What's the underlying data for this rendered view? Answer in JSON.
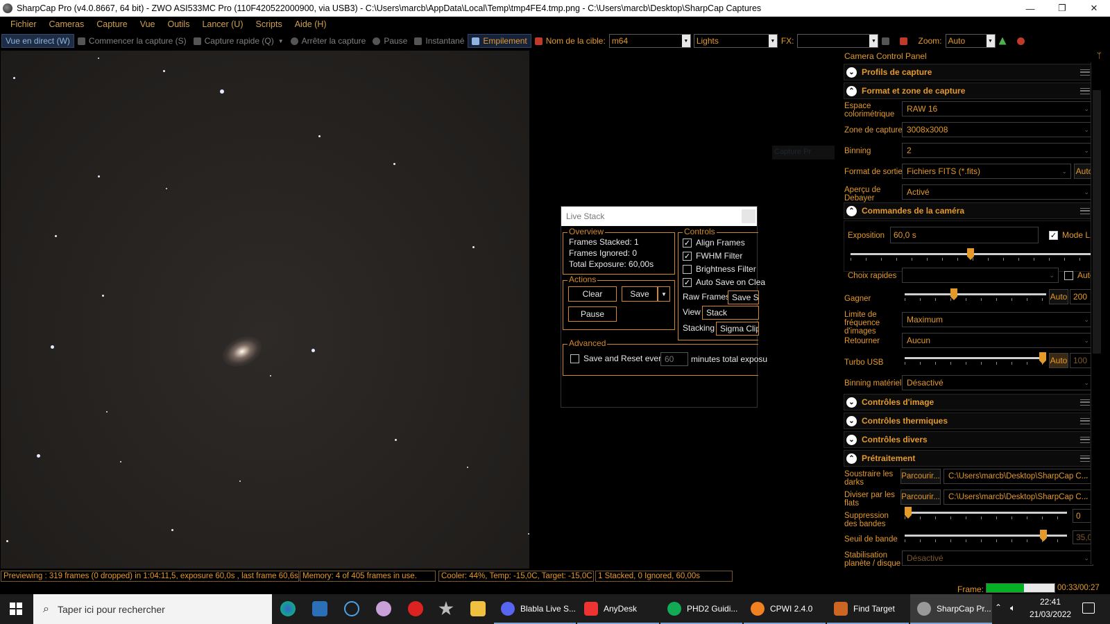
{
  "window": {
    "title": "SharpCap Pro (v4.0.8667, 64 bit) - ZWO ASI533MC Pro (110F420522000900, via USB3) - C:\\Users\\marcb\\AppData\\Local\\Temp\\tmp4FE4.tmp.png - C:\\Users\\marcb\\Desktop\\SharpCap Captures",
    "minimize": "—",
    "maximize": "❐",
    "close": "✕"
  },
  "menu": [
    "Fichier",
    "Cameras",
    "Capture",
    "Vue",
    "Outils",
    "Lancer (U)",
    "Scripts",
    "Aide (H)"
  ],
  "toolbar": {
    "live_view": "Vue en direct (W)",
    "start_capture": "Commencer la capture (S)",
    "quick_capture": "Capture rapide (Q)",
    "stop_capture": "Arrêter la capture",
    "pause": "Pause",
    "snapshot": "Instantané",
    "stacking": "Empilement",
    "target_label": "Nom de la cible:",
    "target_value": "m64",
    "frame_type": "Lights",
    "fx_label": "FX:",
    "fx_value": "",
    "zoom_label": "Zoom:",
    "zoom_value": "Auto"
  },
  "ghost_text": "Capture Pr",
  "live_stack": {
    "title": "Live Stack",
    "overview": {
      "label": "Overview",
      "frames_stacked": "Frames Stacked:  1",
      "frames_ignored": "Frames Ignored:  0",
      "total_exposure": "Total Exposure:    60,00s"
    },
    "actions": {
      "label": "Actions",
      "clear": "Clear",
      "save": "Save",
      "pause": "Pause"
    },
    "controls": {
      "label": "Controls",
      "align_frames": "Align Frames",
      "fwhm_filter": "FWHM Filter",
      "brightness_filter": "Brightness Filter",
      "auto_save": "Auto Save on Clea",
      "raw_frames_label": "Raw Frames",
      "raw_frames_value": "Save St",
      "view_label": "View",
      "view_value": "Stack",
      "stacking_label": "Stacking",
      "stacking_value": "Sigma Clipp"
    },
    "advanced": {
      "label": "Advanced",
      "save_reset": "Save and Reset every",
      "minutes_value": "60",
      "minutes_suffix": "minutes total exposu"
    }
  },
  "panel": {
    "title": "Camera Control Panel",
    "sections": {
      "capture_profiles": "Profils de capture",
      "format_area": "Format et zone de capture",
      "camera_controls": "Commandes de la caméra",
      "image_controls": "Contrôles d'image",
      "thermal_controls": "Contrôles thermiques",
      "misc_controls": "Contrôles divers",
      "preprocessing": "Prétraitement"
    },
    "color_space_label": "Espace colorimétrique",
    "color_space": "RAW 16",
    "capture_area_label": "Zone de capture",
    "capture_area": "3008x3008",
    "binning_label": "Binning",
    "binning": "2",
    "output_format_label": "Format de sortie",
    "output_format": "Fichiers FITS (*.fits)",
    "auto": "Auto",
    "debayer_label": "Aperçu de Debayer",
    "debayer": "Activé",
    "exposure_label": "Exposition",
    "exposure": "60,0 s",
    "lx_mode": "Mode LX",
    "quick_choice_label": "Choix rapides",
    "quick_choice": "",
    "gain_label": "Gagner",
    "gain_value": "200",
    "gain_level": 0.34,
    "exposure_level": 0.5,
    "frame_rate_label": "Limite de fréquence d'images",
    "frame_rate": "Maximum",
    "flip_label": "Retourner",
    "flip": "Aucun",
    "usb_label": "Turbo USB",
    "usb_value": "100",
    "usb_level": 1.0,
    "hw_binning_label": "Binning matériel",
    "hw_binning": "Désactivé",
    "subtract_darks_label": "Soustraire les darks",
    "browse": "Parcourir...",
    "darks_path": "C:\\Users\\marcb\\Desktop\\SharpCap C...",
    "divide_flats_label": "Diviser par les flats",
    "flats_path": "C:\\Users\\marcb\\Desktop\\SharpCap C...",
    "banding_label": "Suppression des bandes",
    "banding_value": "0",
    "banding_level": 0.0,
    "band_threshold_label": "Seuil de bande",
    "band_threshold_value": "35,0",
    "band_threshold_level": 0.87,
    "stabilization_label": "Stabilisation planète / disque",
    "stabilization": "Désactivé"
  },
  "status": {
    "previewing": "Previewing : 319 frames (0 dropped) in 1:04:11,5, exposure 60,0s , last frame 60,6s",
    "memory": "Memory: 4 of 405 frames in use.",
    "cooler": "Cooler: 44%, Temp: -15,0C, Target: -15,0C",
    "stacked": "1 Stacked, 0 Ignored, 60,00s",
    "frame_label": "Frame:",
    "frame_progress": 0.55,
    "frame_time": "00:33/00:27"
  },
  "taskbar": {
    "search_placeholder": "Taper ici pour rechercher",
    "apps": [
      "Blabla Live S...",
      "AnyDesk",
      "PHD2 Guidi...",
      "CPWI 2.4.0",
      "Find Target",
      "SharpCap Pr..."
    ],
    "time": "22:41",
    "date": "21/03/2022"
  }
}
